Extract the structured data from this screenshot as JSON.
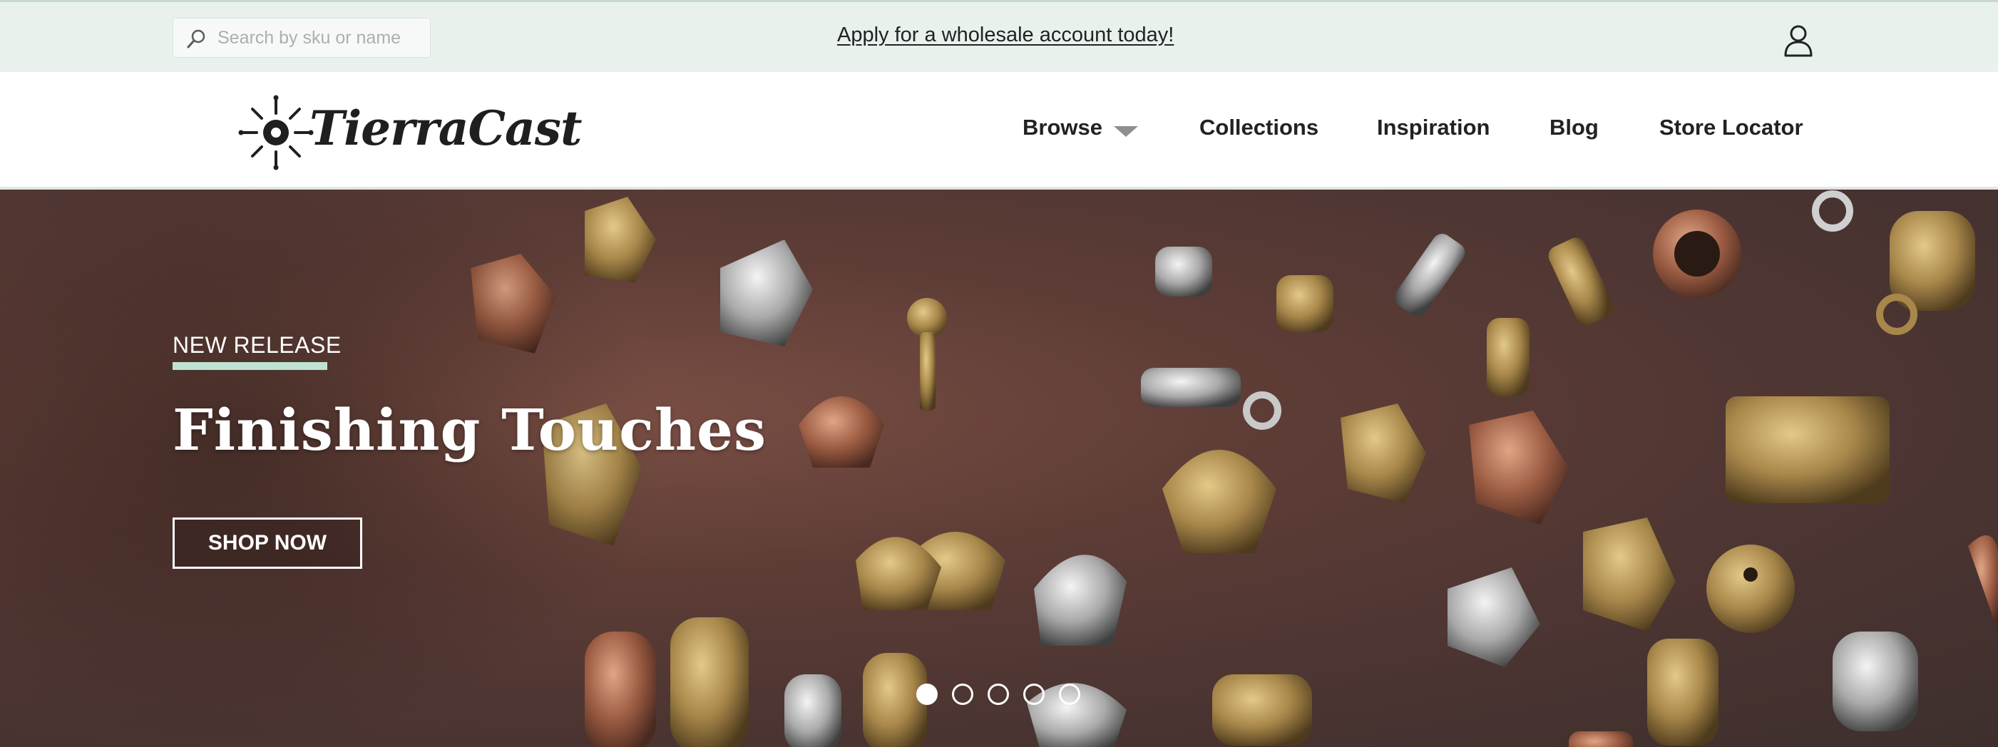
{
  "topbar": {
    "search_placeholder": "Search by sku or name",
    "promo_link": "Apply for a wholesale account today!",
    "account_icon": "user-icon"
  },
  "brand": {
    "name": "TierraCast"
  },
  "nav": {
    "browse": "Browse",
    "collections": "Collections",
    "inspiration": "Inspiration",
    "blog": "Blog",
    "store_locator": "Store Locator"
  },
  "hero": {
    "eyebrow": "NEW RELEASE",
    "headline": "Finishing Touches",
    "cta": "SHOP NOW",
    "slide_count": 5,
    "active_slide": 1
  },
  "colors": {
    "topbar_bg": "#e8f1ec",
    "accent_mint": "#bfe3d2",
    "text_dark": "#222222"
  }
}
